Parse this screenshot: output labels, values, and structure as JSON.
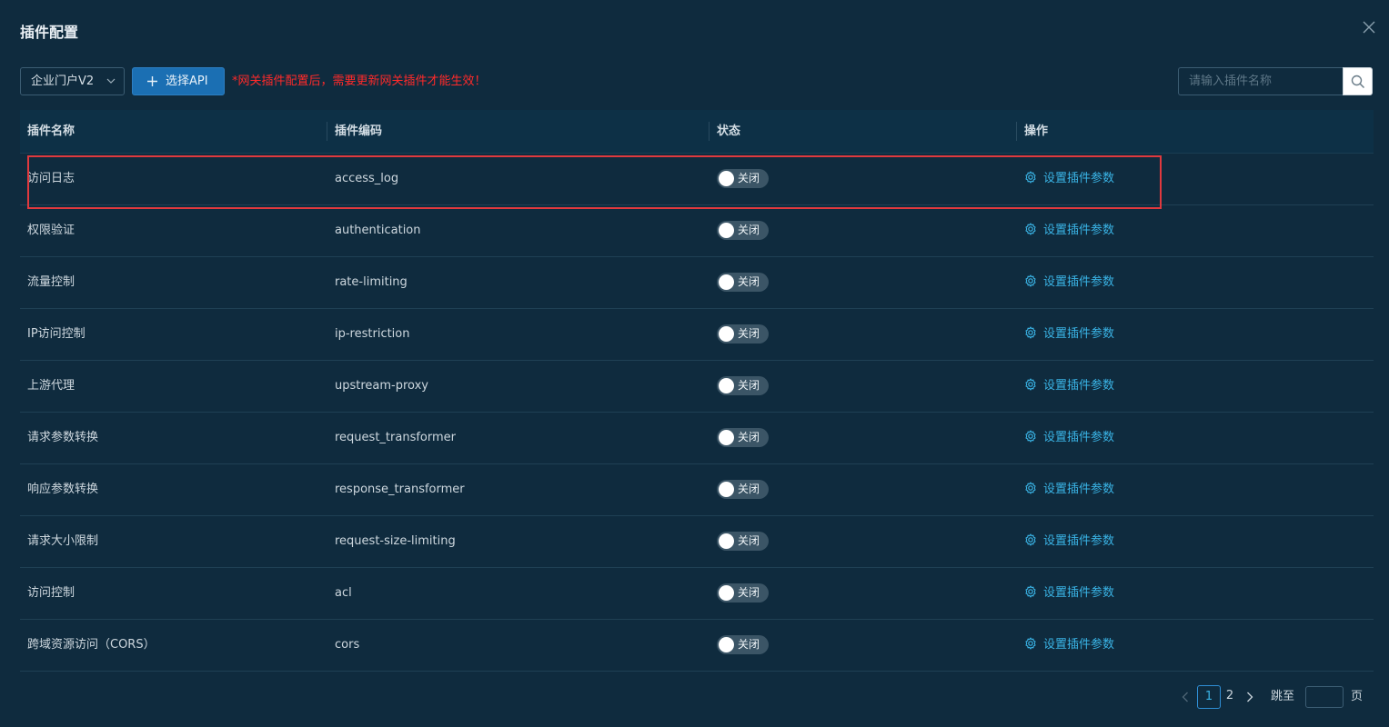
{
  "modal": {
    "title": "插件配置"
  },
  "toolbar": {
    "select_value": "企业门户V2",
    "select_api_label": "选择API",
    "warning": "*网关插件配置后，需要更新网关插件才能生效！",
    "search_placeholder": "请输入插件名称"
  },
  "table": {
    "headers": [
      "插件名称",
      "插件编码",
      "状态",
      "操作"
    ],
    "rows": [
      {
        "name": "访问日志",
        "code": "access_log",
        "status": "关闭",
        "action": "设置插件参数"
      },
      {
        "name": "权限验证",
        "code": "authentication",
        "status": "关闭",
        "action": "设置插件参数"
      },
      {
        "name": "流量控制",
        "code": "rate-limiting",
        "status": "关闭",
        "action": "设置插件参数"
      },
      {
        "name": "IP访问控制",
        "code": "ip-restriction",
        "status": "关闭",
        "action": "设置插件参数"
      },
      {
        "name": "上游代理",
        "code": "upstream-proxy",
        "status": "关闭",
        "action": "设置插件参数"
      },
      {
        "name": "请求参数转换",
        "code": "request_transformer",
        "status": "关闭",
        "action": "设置插件参数"
      },
      {
        "name": "响应参数转换",
        "code": "response_transformer",
        "status": "关闭",
        "action": "设置插件参数"
      },
      {
        "name": "请求大小限制",
        "code": "request-size-limiting",
        "status": "关闭",
        "action": "设置插件参数"
      },
      {
        "name": "访问控制",
        "code": "acl",
        "status": "关闭",
        "action": "设置插件参数"
      },
      {
        "name": "跨域资源访问（CORS）",
        "code": "cors",
        "status": "关闭",
        "action": "设置插件参数"
      }
    ]
  },
  "pagination": {
    "pages": [
      "1",
      "2"
    ],
    "current": "1",
    "jump_label": "跳至",
    "page_unit": "页"
  },
  "icons": {
    "close": "close-icon",
    "select_chevron": "chevron-down-icon",
    "add": "plus-icon",
    "search": "search-icon",
    "settings": "gear-icon",
    "prev": "chevron-left-icon",
    "next": "chevron-right-icon"
  },
  "colors": {
    "modal_bg": "#0f2b3e",
    "primary_button": "#1b6fb3",
    "warning_text": "#ff2a2a",
    "link": "#3ab4e6",
    "highlight_border": "#e0393e",
    "switch_off": "#3b5566"
  }
}
